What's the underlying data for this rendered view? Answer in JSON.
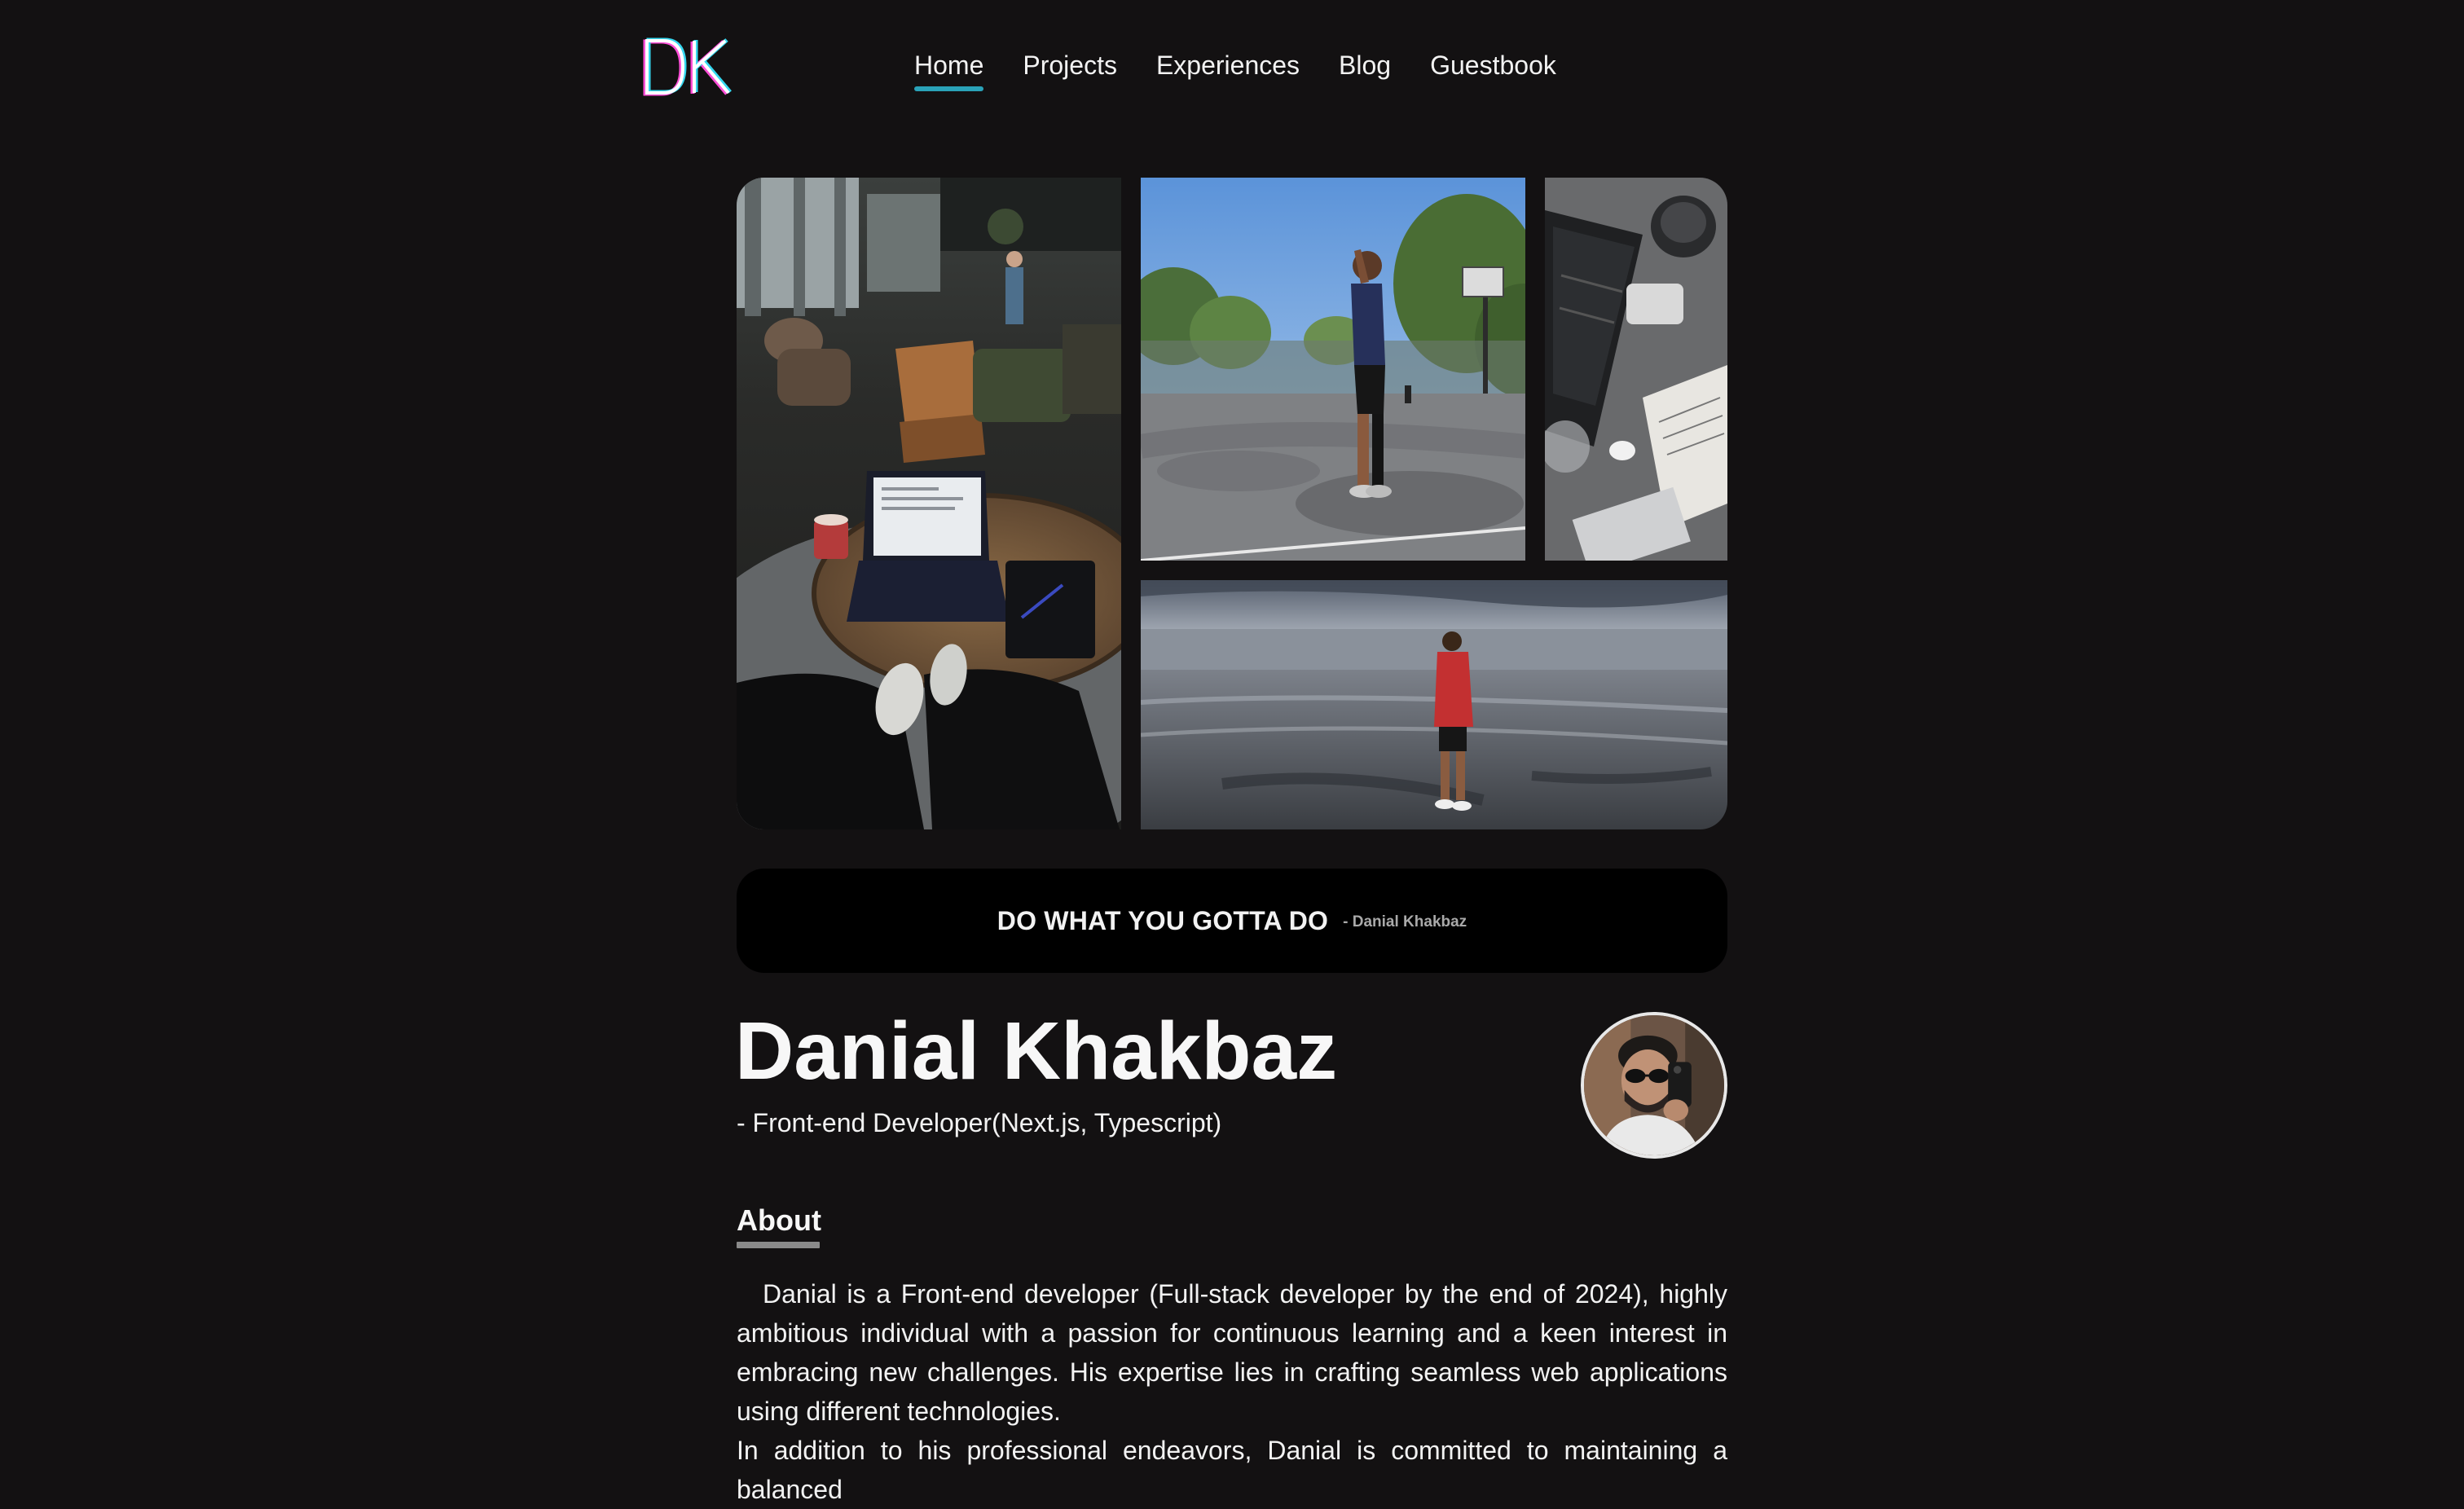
{
  "header": {
    "logo_text": "DK",
    "nav": [
      {
        "label": "Home",
        "active": true
      },
      {
        "label": "Projects",
        "active": false
      },
      {
        "label": "Experiences",
        "active": false
      },
      {
        "label": "Blog",
        "active": false
      },
      {
        "label": "Guestbook",
        "active": false
      }
    ]
  },
  "gallery": {
    "photos": [
      {
        "name": "cafe-laptop-photo"
      },
      {
        "name": "basketball-court-photo"
      },
      {
        "name": "desk-laptop-photo"
      },
      {
        "name": "beach-photo"
      }
    ]
  },
  "quote": {
    "text": "DO WHAT YOU GOTTA DO",
    "author": "- Danial Khakbaz"
  },
  "profile": {
    "name": "Danial Khakbaz",
    "role": "- Front-end Developer(Next.js, Typescript)"
  },
  "about": {
    "heading": "About",
    "paragraph1": "Danial is a Front-end developer (Full-stack developer by the end of 2024), highly ambitious individual with a passion for continuous learning and a keen interest in embracing new challenges. His expertise lies in crafting seamless web applications using different technologies.",
    "paragraph2": "In addition to his professional endeavors, Danial is committed to maintaining a balanced"
  },
  "colors": {
    "background": "#131112",
    "accent": "#2aa2b8",
    "quote_bg": "#000000"
  }
}
